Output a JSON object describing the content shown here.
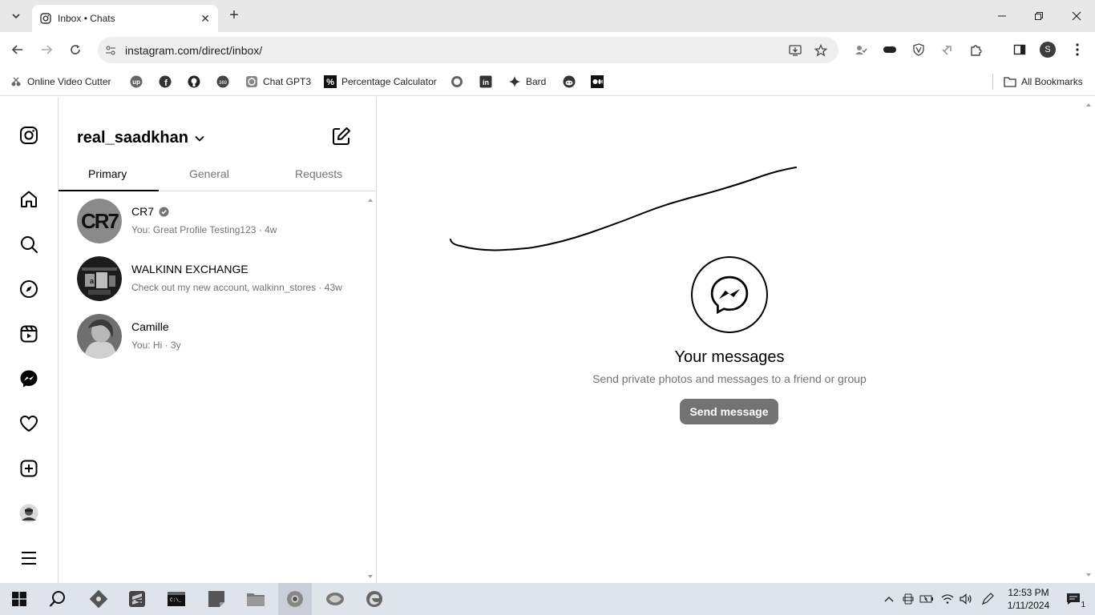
{
  "browser": {
    "tab_title": "Inbox • Chats",
    "url": "instagram.com/direct/inbox/",
    "profile_initial": "S",
    "bookmarks": [
      {
        "label": "Online Video Cutter",
        "icon": "video-cutter-icon"
      },
      {
        "label": "",
        "icon": "upwork-icon"
      },
      {
        "label": "",
        "icon": "facebook-icon"
      },
      {
        "label": "",
        "icon": "github-icon"
      },
      {
        "label": "",
        "icon": "369-icon"
      },
      {
        "label": "Chat GPT3",
        "icon": "chatgpt-icon"
      },
      {
        "label": "Percentage Calculator",
        "icon": "percent-icon"
      },
      {
        "label": "",
        "icon": "whatsapp-icon"
      },
      {
        "label": "",
        "icon": "linkedin-icon"
      },
      {
        "label": "Bard",
        "icon": "bard-sparkle-icon"
      },
      {
        "label": "",
        "icon": "reddit-icon"
      },
      {
        "label": "",
        "icon": "medium-icon"
      }
    ],
    "all_bookmarks": "All Bookmarks"
  },
  "inbox": {
    "username": "real_saadkhan",
    "tabs": [
      "Primary",
      "General",
      "Requests"
    ],
    "active_tab": "Primary",
    "conversations": [
      {
        "name": "CR7",
        "verified": true,
        "preview": "You: Great Profile Testing123 · 4w",
        "avatar_text": "CR7"
      },
      {
        "name": "WALKINN EXCHANGE",
        "verified": false,
        "preview": "Check out my new account, walkinn_stores · 43w"
      },
      {
        "name": "Camille",
        "verified": false,
        "preview": "You: Hi · 3y"
      }
    ]
  },
  "main": {
    "title": "Your messages",
    "subtitle": "Send private photos and messages to a friend or group",
    "button": "Send message"
  },
  "taskbar": {
    "time": "12:53 PM",
    "date": "1/11/2024",
    "notification_count": "1"
  }
}
